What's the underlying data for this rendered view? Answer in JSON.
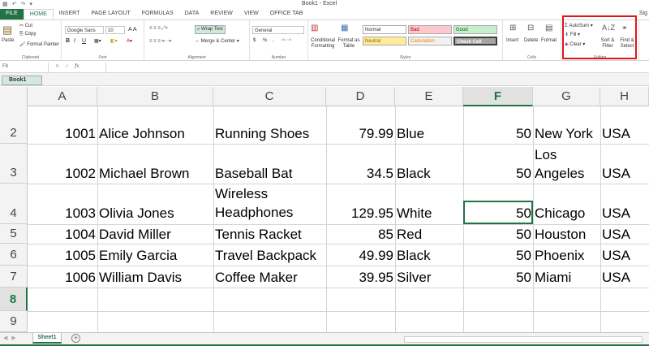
{
  "titlebar": {
    "title": "Book1 - Excel",
    "qat": [
      "▦",
      "↶",
      "↷",
      "▾"
    ]
  },
  "tabs": [
    "FILE",
    "HOME",
    "INSERT",
    "PAGE LAYOUT",
    "FORMULAS",
    "DATA",
    "REVIEW",
    "VIEW",
    "OFFICE TAB"
  ],
  "signin": "Sig",
  "ribbon": {
    "clipboard": {
      "paste": "Paste",
      "cut": "Cut",
      "copy": "Copy",
      "format_painter": "Format Painter",
      "label": "Clipboard"
    },
    "font": {
      "name": "Google Sans",
      "size": "10",
      "label": "Font",
      "bold": "B",
      "italic": "I",
      "underline": "U"
    },
    "alignment": {
      "wrap": "Wrap Text",
      "merge": "Merge & Center",
      "label": "Alignment"
    },
    "number": {
      "format": "General",
      "currency": "$",
      "percent": "%",
      "comma": ",",
      "label": "Number"
    },
    "styles": {
      "cond": "Conditional Formatting",
      "table": "Format as Table",
      "label": "Styles",
      "cells": [
        {
          "text": "Normal",
          "bg": "#ffffff",
          "fg": "#000000"
        },
        {
          "text": "Bad",
          "bg": "#ffc7ce",
          "fg": "#9c0006"
        },
        {
          "text": "Good",
          "bg": "#c6efce",
          "fg": "#006100"
        },
        {
          "text": "Neutral",
          "bg": "#ffeb9c",
          "fg": "#9c6500"
        },
        {
          "text": "Calculation",
          "bg": "#f2f2f2",
          "fg": "#fa7d00"
        },
        {
          "text": "Check Cell",
          "bg": "#a5a5a5",
          "fg": "#ffffff"
        }
      ]
    },
    "cells": {
      "insert": "Insert",
      "delete": "Delete",
      "format": "Format",
      "label": "Cells"
    },
    "editing": {
      "autosum": "AutoSum",
      "fill": "Fill",
      "clear": "Clear",
      "sort": "Sort & Filter",
      "find": "Find & Select",
      "label": "Editing"
    }
  },
  "formula_bar": {
    "name_box": "F8",
    "fx": "fx",
    "content": ""
  },
  "workbook_tab": "Book1",
  "columns": [
    "A",
    "B",
    "C",
    "D",
    "E",
    "F",
    "G",
    "H"
  ],
  "selected_col": "F",
  "selected_row": "8",
  "rows": [
    {
      "num": "2",
      "id": "1001",
      "name": "Alice Johnson",
      "product": "Running Shoes",
      "price": "79.99",
      "color": "Blue",
      "qty": "50",
      "city": "New York",
      "country": "USA"
    },
    {
      "num": "3",
      "id": "1002",
      "name": "Michael Brown",
      "product": "Baseball Bat",
      "price": "34.5",
      "color": "Black",
      "qty": "50",
      "city": "Los Angeles",
      "country": "USA"
    },
    {
      "num": "4",
      "id": "1003",
      "name": "Olivia Jones",
      "product": "Wireless Headphones",
      "price": "129.95",
      "color": "White",
      "qty": "50",
      "city": "Chicago",
      "country": "USA"
    },
    {
      "num": "5",
      "id": "1004",
      "name": "David Miller",
      "product": "Tennis Racket",
      "price": "85",
      "color": "Red",
      "qty": "50",
      "city": "Houston",
      "country": "USA"
    },
    {
      "num": "6",
      "id": "1005",
      "name": "Emily Garcia",
      "product": "Travel Backpack",
      "price": "49.99",
      "color": "Black",
      "qty": "50",
      "city": "Phoenix",
      "country": "USA"
    },
    {
      "num": "7",
      "id": "1006",
      "name": "William Davis",
      "product": "Coffee Maker",
      "price": "39.95",
      "color": "Silver",
      "qty": "50",
      "city": "Miami",
      "country": "USA"
    }
  ],
  "empty_rows": [
    "8",
    "9"
  ],
  "sheet_tab": "Sheet1",
  "add_sheet": "+"
}
